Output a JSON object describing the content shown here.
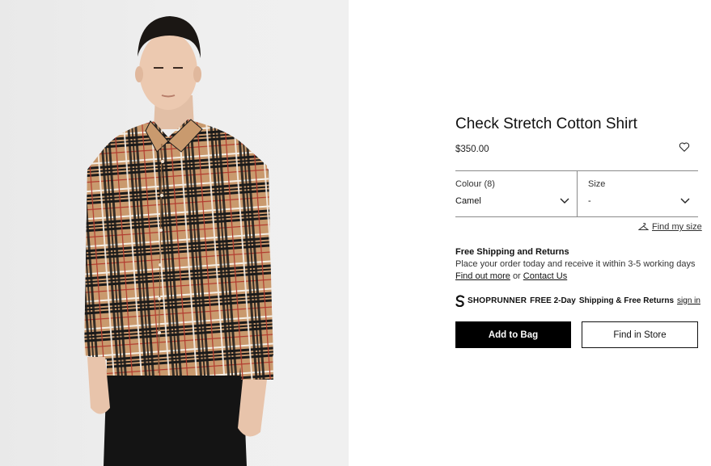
{
  "product": {
    "title": "Check Stretch Cotton Shirt",
    "price": "$350.00",
    "image_alt": "model wearing camel check shirt"
  },
  "selectors": {
    "colour_label": "Colour (8)",
    "colour_value": "Camel",
    "size_label": "Size",
    "size_value": "-"
  },
  "find_size": "Find my size",
  "shipping": {
    "heading": "Free Shipping and Returns",
    "text": "Place your order today and receive it within 3-5 working days",
    "link_more": "Find out more",
    "or": "or",
    "link_contact": "Contact Us"
  },
  "shoprunner": {
    "brand": "SHOPRUNNER",
    "free": "FREE 2-Day",
    "text": "Shipping & Free Returns",
    "sign_in": "sign in"
  },
  "buttons": {
    "add_to_bag": "Add to Bag",
    "find_in_store": "Find in Store"
  },
  "colors": {
    "shirt_camel": "#c99a6e",
    "check_black": "#1a1a1a",
    "check_red": "#b23a2e",
    "check_white": "#f4efe6",
    "button_black": "#000000"
  },
  "icons": [
    "heart-icon",
    "chevron-down-icon",
    "hanger-icon",
    "shoprunner-logo-icon"
  ]
}
